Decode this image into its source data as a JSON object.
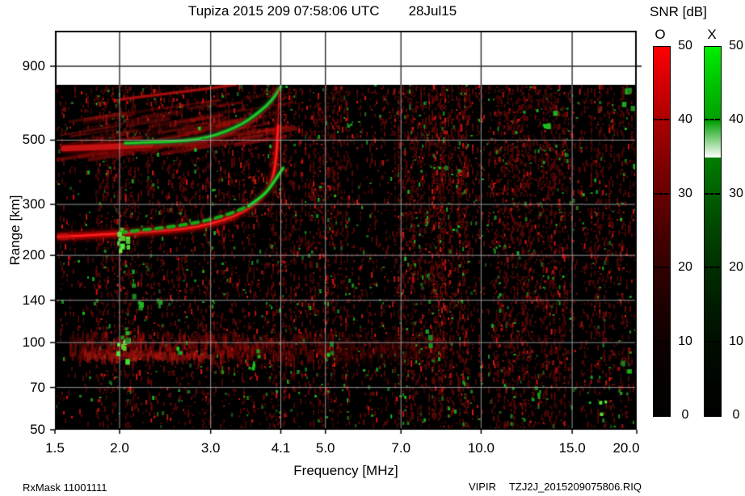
{
  "header": {
    "title": "Tupiza 2015 209 07:58:06 UTC",
    "date": "28Jul15"
  },
  "colorbar_panel": {
    "title": "SNR [dB]",
    "tick_labels": [
      "50",
      "40",
      "30",
      "20",
      "10",
      "0"
    ],
    "bars": [
      {
        "label": "O",
        "color": "#ff0000"
      },
      {
        "label": "X",
        "color": "#00ee00"
      }
    ],
    "min": 0,
    "max": 50
  },
  "footer": {
    "rx_mask": "RxMask 11001111",
    "system": "VIPIR",
    "file": "TZJ2J_2015209075806.RIQ"
  },
  "chart_data": {
    "type": "heatmap",
    "subtype": "ionogram",
    "station": "Tupiza",
    "title": "Tupiza 2015 209 07:58:06 UTC",
    "date_label": "28Jul15",
    "xlabel": "Frequency [MHz]",
    "ylabel": "Range [km]",
    "x_scale": "log",
    "x_tick_labels": [
      "1.5",
      "2.0",
      "3.0",
      "4.1",
      "5.0",
      "7.0",
      "10.0",
      "15.0",
      "20.0"
    ],
    "x_range_mhz": [
      1.5,
      20.0
    ],
    "y_scale": "log",
    "y_tick_labels": [
      "900",
      "500",
      "300",
      "200",
      "140",
      "100",
      "70",
      "50"
    ],
    "y_range_km": [
      50,
      1190
    ],
    "data_top_range_km": 775,
    "grid": true,
    "snr_scale": {
      "label": "SNR [dB]",
      "min": 0,
      "max": 50,
      "ticks": [
        0,
        10,
        20,
        30,
        40,
        50
      ],
      "modes": [
        {
          "name": "O",
          "color": "#ff0000"
        },
        {
          "name": "X",
          "color": "#00ee00"
        }
      ]
    },
    "critical_frequency_mhz": 4.1,
    "traces": [
      {
        "name": "F-layer 1st hop O-mode",
        "mode": "O",
        "color": "#e01010",
        "points": [
          [
            1.52,
            232
          ],
          [
            1.9,
            236
          ],
          [
            2.4,
            243
          ],
          [
            2.75,
            249
          ],
          [
            3.05,
            259
          ],
          [
            3.35,
            274
          ],
          [
            3.6,
            294
          ],
          [
            3.8,
            321
          ],
          [
            3.93,
            354
          ],
          [
            4.0,
            404
          ],
          [
            4.03,
            470
          ],
          [
            4.05,
            560
          ],
          [
            4.06,
            660
          ],
          [
            4.07,
            745
          ]
        ]
      },
      {
        "name": "F-layer 1st hop X-mode",
        "mode": "X",
        "color": "#22c822",
        "points": [
          [
            2.0,
            240
          ],
          [
            2.5,
            250
          ],
          [
            2.9,
            262
          ],
          [
            3.25,
            277
          ],
          [
            3.55,
            296
          ],
          [
            3.8,
            322
          ],
          [
            3.95,
            352
          ],
          [
            4.06,
            380
          ],
          [
            4.14,
            400
          ]
        ]
      },
      {
        "name": "F-layer 2nd hop O-mode",
        "mode": "O",
        "color": "#b81010",
        "points": [
          [
            1.56,
            468
          ],
          [
            1.9,
            474
          ],
          [
            2.3,
            482
          ],
          [
            2.7,
            492
          ],
          [
            3.0,
            506
          ],
          [
            3.3,
            532
          ],
          [
            3.55,
            568
          ],
          [
            3.75,
            612
          ],
          [
            3.9,
            664
          ],
          [
            4.0,
            718
          ],
          [
            4.04,
            752
          ]
        ]
      },
      {
        "name": "F-layer 2nd hop X-mode",
        "mode": "X",
        "color": "#1cb41c",
        "points": [
          [
            2.05,
            488
          ],
          [
            2.4,
            492
          ],
          [
            2.7,
            498
          ],
          [
            2.95,
            510
          ],
          [
            3.2,
            534
          ],
          [
            3.45,
            568
          ],
          [
            3.65,
            608
          ],
          [
            3.85,
            658
          ],
          [
            4.0,
            710
          ],
          [
            4.1,
            765
          ]
        ]
      },
      {
        "name": "upper faint arc",
        "mode": "O",
        "color": "#c01212",
        "points": [
          [
            2.0,
            690
          ],
          [
            2.45,
            722
          ],
          [
            2.95,
            753
          ],
          [
            3.35,
            778
          ]
        ]
      }
    ],
    "regions": [
      {
        "name": "E-region echo band",
        "color": "red",
        "f_mhz": [
          1.6,
          8.6
        ],
        "range_km": [
          85,
          114
        ],
        "bright_f_mhz": [
          1.7,
          3.0
        ]
      },
      {
        "name": "2nd-hop diffuse spread echo",
        "color": "red",
        "f_mhz": [
          1.62,
          4.15
        ],
        "range_km": [
          470,
          765
        ],
        "texture": "diagonal-stripes"
      }
    ],
    "noise": {
      "description": "speckle noise columns, density 0-1 per frequency band",
      "red_bands": [
        [
          1.5,
          1.8,
          0.1
        ],
        [
          1.8,
          2.12,
          0.3
        ],
        [
          2.12,
          3.3,
          0.22
        ],
        [
          3.3,
          3.95,
          0.27
        ],
        [
          3.95,
          5.5,
          0.36
        ],
        [
          5.5,
          6.8,
          0.15
        ],
        [
          6.8,
          9.6,
          0.45
        ],
        [
          9.6,
          10.6,
          0.2
        ],
        [
          10.6,
          14.5,
          0.38
        ],
        [
          14.5,
          16.3,
          0.2
        ],
        [
          16.3,
          18.8,
          0.3
        ],
        [
          18.8,
          20.0,
          0.22
        ]
      ],
      "green_base_density": 0.006,
      "green_band_factor": 0.04
    },
    "green_clusters": [
      {
        "f": 2.02,
        "km": 228,
        "n": 10,
        "bright": true
      },
      {
        "f": 2.02,
        "km": 95,
        "n": 8,
        "bright": true
      },
      {
        "f": 2.06,
        "km": 108,
        "n": 4,
        "bright": false
      },
      {
        "f": 2.15,
        "km": 140,
        "n": 4,
        "bright": false
      },
      {
        "f": 2.32,
        "km": 133,
        "n": 3,
        "bright": false
      },
      {
        "f": 2.1,
        "km": 175,
        "n": 3,
        "bright": false
      },
      {
        "f": 2.85,
        "km": 510,
        "n": 3,
        "bright": false
      },
      {
        "f": 2.6,
        "km": 100,
        "n": 3,
        "bright": false
      },
      {
        "f": 3.62,
        "km": 89,
        "n": 5,
        "bright": false
      },
      {
        "f": 5.15,
        "km": 93,
        "n": 3,
        "bright": false
      },
      {
        "f": 7.9,
        "km": 108,
        "n": 3,
        "bright": false
      },
      {
        "f": 8.3,
        "km": 390,
        "n": 2,
        "bright": false
      },
      {
        "f": 12.6,
        "km": 66,
        "n": 3,
        "bright": false
      },
      {
        "f": 13.5,
        "km": 600,
        "n": 3,
        "bright": false
      },
      {
        "f": 17.3,
        "km": 58,
        "n": 3,
        "bright": true
      },
      {
        "f": 18.9,
        "km": 80,
        "n": 3,
        "bright": false
      },
      {
        "f": 19.0,
        "km": 700,
        "n": 4,
        "bright": false
      },
      {
        "f": 19.4,
        "km": 435,
        "n": 3,
        "bright": false
      }
    ]
  }
}
